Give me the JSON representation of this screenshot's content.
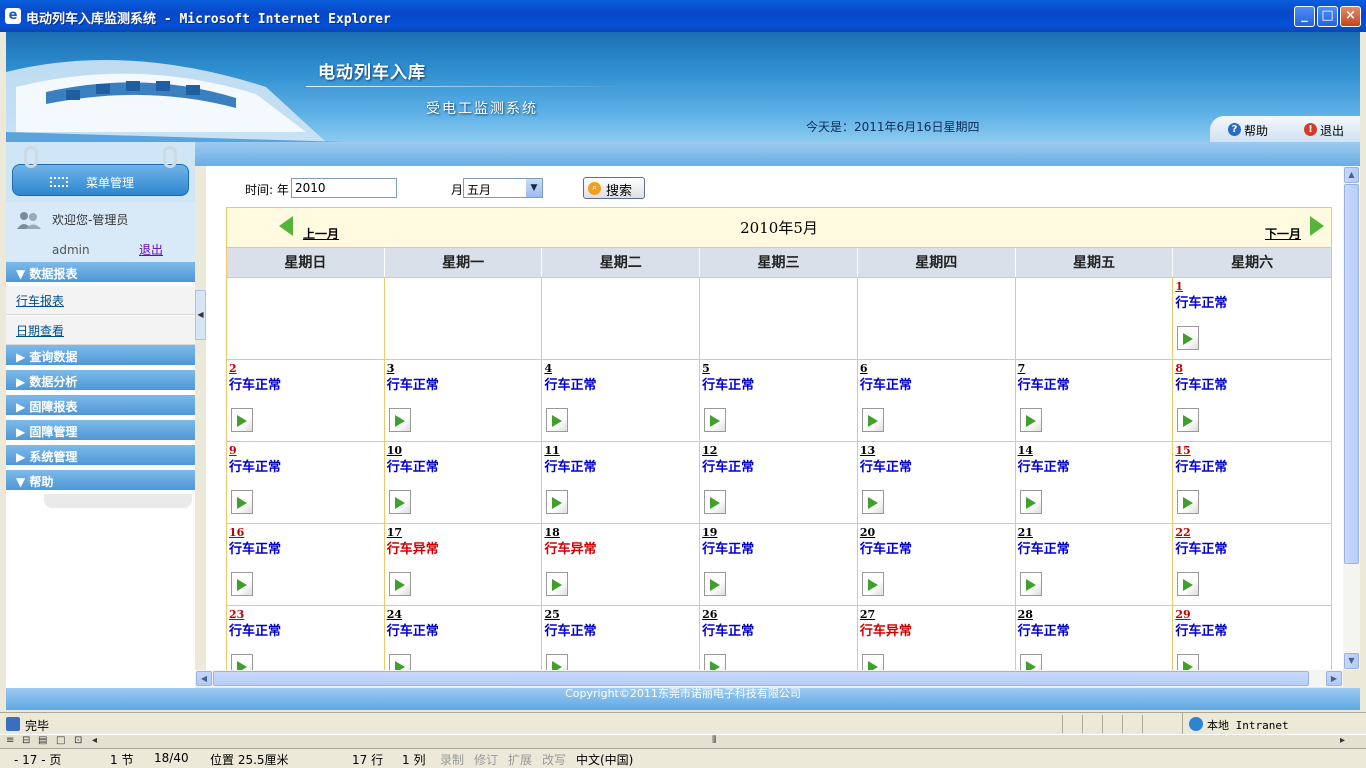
{
  "window": {
    "title": "电动列车入库监测系统 - Microsoft Internet Explorer"
  },
  "header": {
    "system_name": "电动列车入库",
    "system_subtitle": "受电工监测系统",
    "date_text": "今天是：2011年6月16日星期四",
    "help": "帮助",
    "exit": "退出"
  },
  "sidebar": {
    "menu_title": "菜单管理",
    "welcome": "欢迎您-管理员",
    "username": "admin",
    "logout": "退出",
    "categories": [
      {
        "label": "数据报表",
        "expanded": true,
        "items": [
          "行车报表",
          "日期查看"
        ]
      },
      {
        "label": "查询数据",
        "expanded": false
      },
      {
        "label": "数据分析",
        "expanded": false
      },
      {
        "label": "固障报表",
        "expanded": false
      },
      {
        "label": "固障管理",
        "expanded": false
      },
      {
        "label": "系统管理",
        "expanded": false
      },
      {
        "label": "帮助",
        "expanded": true
      }
    ]
  },
  "search": {
    "time_label": "时间: 年",
    "year_value": "2010",
    "month_label": "月",
    "month_value": "五月",
    "search_button": "搜索"
  },
  "calendar": {
    "month_title": "2010年5月",
    "prev": "上一月",
    "next": "下一月",
    "weekdays": [
      "星期日",
      "星期一",
      "星期二",
      "星期三",
      "星期四",
      "星期五",
      "星期六"
    ],
    "status_normal": "行车正常",
    "status_abnormal": "行车异常",
    "weeks": [
      [
        null,
        null,
        null,
        null,
        null,
        null,
        {
          "day": "1",
          "status": "行车正常",
          "weekend": true
        }
      ],
      [
        {
          "day": "2",
          "status": "行车正常",
          "weekend": true
        },
        {
          "day": "3",
          "status": "行车正常"
        },
        {
          "day": "4",
          "status": "行车正常"
        },
        {
          "day": "5",
          "status": "行车正常"
        },
        {
          "day": "6",
          "status": "行车正常"
        },
        {
          "day": "7",
          "status": "行车正常"
        },
        {
          "day": "8",
          "status": "行车正常",
          "weekend": true
        }
      ],
      [
        {
          "day": "9",
          "status": "行车正常",
          "weekend": true
        },
        {
          "day": "10",
          "status": "行车正常"
        },
        {
          "day": "11",
          "status": "行车正常"
        },
        {
          "day": "12",
          "status": "行车正常"
        },
        {
          "day": "13",
          "status": "行车正常"
        },
        {
          "day": "14",
          "status": "行车正常"
        },
        {
          "day": "15",
          "status": "行车正常",
          "weekend": true
        }
      ],
      [
        {
          "day": "16",
          "status": "行车正常",
          "weekend": true
        },
        {
          "day": "17",
          "status": "行车异常"
        },
        {
          "day": "18",
          "status": "行车异常"
        },
        {
          "day": "19",
          "status": "行车正常"
        },
        {
          "day": "20",
          "status": "行车正常"
        },
        {
          "day": "21",
          "status": "行车正常"
        },
        {
          "day": "22",
          "status": "行车正常",
          "weekend": true
        }
      ],
      [
        {
          "day": "23",
          "status": "行车正常",
          "weekend": true
        },
        {
          "day": "24",
          "status": "行车正常"
        },
        {
          "day": "25",
          "status": "行车正常"
        },
        {
          "day": "26",
          "status": "行车正常"
        },
        {
          "day": "27",
          "status": "行车异常"
        },
        {
          "day": "28",
          "status": "行车正常"
        },
        {
          "day": "29",
          "status": "行车正常",
          "weekend": true
        }
      ]
    ]
  },
  "footer": {
    "copyright": "Copyright©2011东莞市诺丽电子科技有限公司"
  },
  "statusbar": {
    "status": "完毕",
    "zone": "本地 Intranet"
  },
  "wordbar": {
    "page": "- 17 - 页",
    "section": "1 节",
    "pages": "18/40",
    "position": "位置 25.5厘米",
    "line": "17 行",
    "column": "1 列",
    "rec": "录制",
    "trk": "修订",
    "ext": "扩展",
    "ovr": "改写",
    "lang": "中文(中国)"
  },
  "colors": {
    "accent": "#4f97d6",
    "normal_status": "#0000cc",
    "abnormal_status": "#d00000",
    "weekend_day": "#c00000",
    "calendar_border": "#f2c66d"
  }
}
